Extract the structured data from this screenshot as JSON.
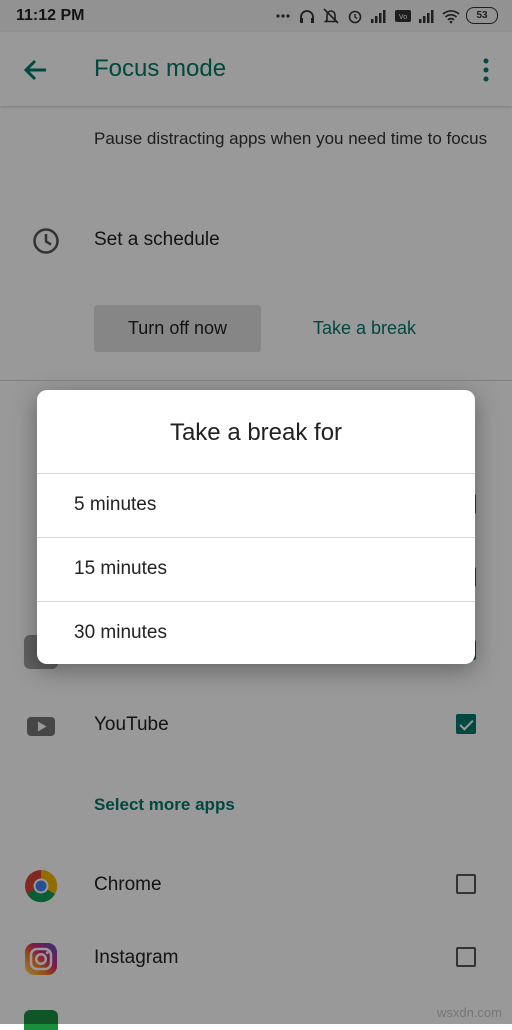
{
  "status_bar": {
    "time": "11:12 PM",
    "battery": "53",
    "icons": [
      "dots-icon",
      "headphones-icon",
      "bell-off-icon",
      "alarm-icon",
      "signal-icon",
      "volte-icon",
      "signal-icon",
      "wifi-icon",
      "battery-icon"
    ]
  },
  "app_bar": {
    "title": "Focus mode",
    "back_icon": "arrow-back-icon",
    "menu_icon": "more-vert-icon"
  },
  "description": "Pause distracting apps when you need time to focus",
  "schedule": {
    "label": "Set a schedule",
    "icon": "clock-icon"
  },
  "buttons": {
    "turn_off": "Turn off now",
    "take_break": "Take a break"
  },
  "apps_selected": [
    {
      "name": "YouTube",
      "checked": true
    }
  ],
  "select_more": "Select more apps",
  "apps_more": [
    {
      "name": "Chrome",
      "checked": false
    },
    {
      "name": "Instagram",
      "checked": false
    }
  ],
  "dialog": {
    "title": "Take a break for",
    "options": [
      "5 minutes",
      "15 minutes",
      "30 minutes"
    ]
  },
  "watermark": "wsxdn.com",
  "colors": {
    "accent": "#00796b",
    "scrim": "rgba(0,0,0,0.4)"
  }
}
